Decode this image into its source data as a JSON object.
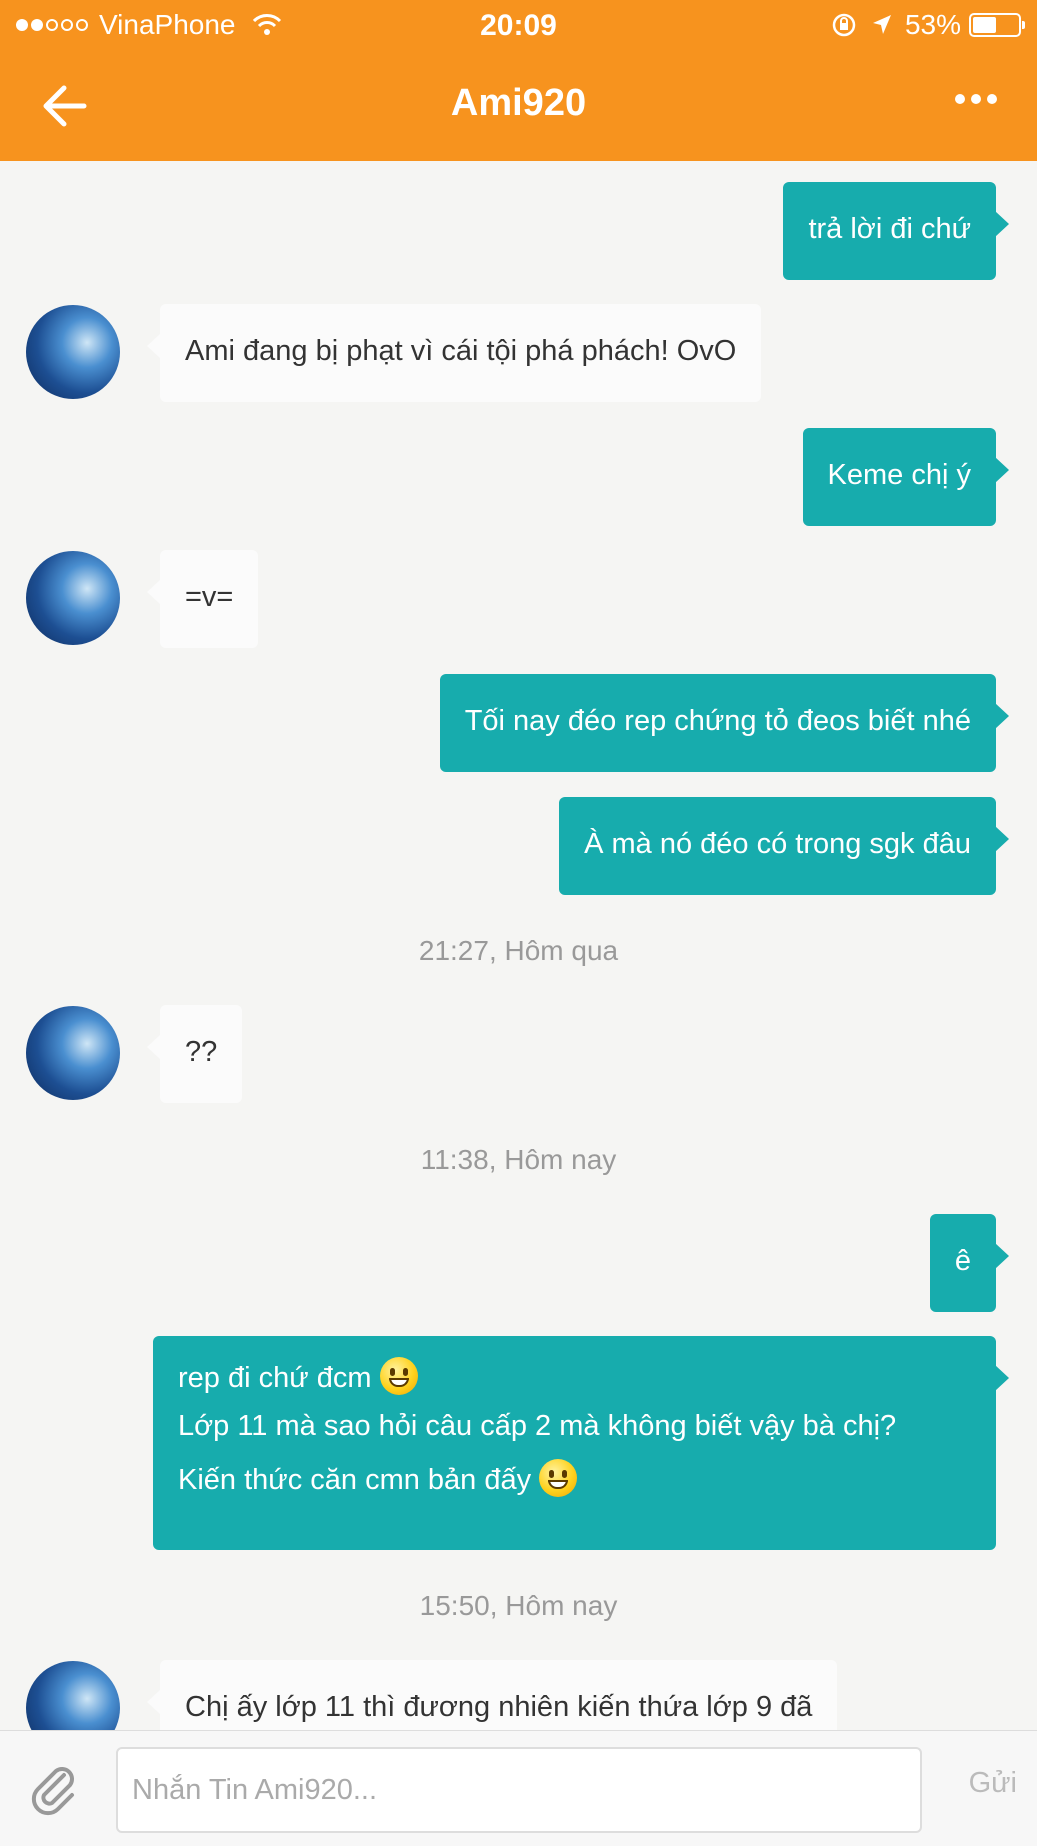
{
  "status_bar": {
    "carrier": "VinaPhone",
    "time": "20:09",
    "battery": "53%",
    "battery_level": 0.53
  },
  "nav": {
    "title": "Ami920"
  },
  "messages": [
    {
      "dir": "out",
      "text": "trả lời đi chứ"
    },
    {
      "dir": "in",
      "text": "Ami đang bị phạt vì cái tội phá phách! OvO"
    },
    {
      "dir": "out",
      "text": "Keme chị ý"
    },
    {
      "dir": "in",
      "text": "=v="
    },
    {
      "dir": "out",
      "text": "Tối nay đéo rep chứng tỏ đeos biết nhé"
    },
    {
      "dir": "out",
      "text": "À mà nó đéo có trong sgk đâu"
    },
    {
      "dir": "in",
      "text": "??"
    },
    {
      "dir": "out",
      "text": "ê"
    },
    {
      "dir": "out",
      "lines": [
        "rep đi chứ đcm",
        "Lớp 11 mà sao hỏi câu cấp 2 mà không biết vậy bà chị?",
        "Kiến thức căn cmn bản đấy"
      ]
    },
    {
      "dir": "in",
      "text": "Chị ấy lớp 11 thì đương nhiên kiến thứa lớp 9 đã"
    }
  ],
  "timestamps": [
    "21:27, Hôm qua",
    "11:38, Hôm nay",
    "15:50, Hôm nay"
  ],
  "composer": {
    "placeholder": "Nhắn Tin Ami920...",
    "send_label": "Gửi"
  },
  "colors": {
    "header": "#f7931e",
    "outgoing_bubble": "#17acad",
    "incoming_bubble": "#fbfbfb"
  },
  "icons": [
    "back-arrow-icon",
    "more-dots-icon",
    "paperclip-icon",
    "wifi-icon",
    "lock-rotation-icon",
    "location-arrow-icon",
    "battery-icon"
  ]
}
